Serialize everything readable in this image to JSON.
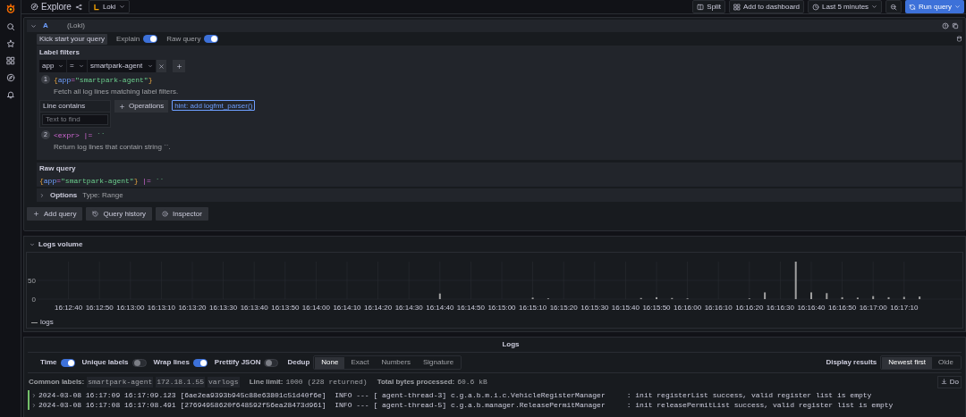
{
  "top_bar": {
    "title": "Explore",
    "datasource": "Loki",
    "buttons": [
      {
        "kind": "split",
        "label": "Split"
      },
      {
        "kind": "dashboard",
        "label": "Add to dashboard"
      },
      {
        "kind": "time",
        "label": "Last 5 minutes"
      },
      {
        "kind": "zoom"
      },
      {
        "kind": "run",
        "label": "Run query"
      }
    ]
  },
  "query": {
    "letter": "A",
    "datasource": "(Loki)",
    "kick_start": "Kick start your query",
    "toggles": [
      {
        "label": "Explain",
        "on": true
      },
      {
        "label": "Raw query",
        "on": true
      }
    ],
    "label_filters": {
      "title": "Label filters",
      "label": "app",
      "operator": "=",
      "value": "smartpark-agent"
    },
    "steps": [
      {
        "number": "1",
        "code": [
          {
            "text": "{",
            "kind": "punct"
          },
          {
            "text": "app",
            "kind": "label"
          },
          {
            "text": "=",
            "kind": "op"
          },
          {
            "text": "\"smartpark-agent\"",
            "kind": "string"
          },
          {
            "text": "}",
            "kind": "punct"
          }
        ],
        "description": "Fetch all log lines matching label filters."
      },
      {
        "number": "2",
        "code": [
          {
            "text": "<expr>",
            "kind": "op"
          },
          {
            "text": " |= ",
            "kind": "op"
          },
          {
            "text": "``",
            "kind": "string"
          }
        ],
        "description": "Return log lines that contain string ``."
      }
    ],
    "operation": {
      "title": "Line contains",
      "placeholder": "Text to find",
      "button": "Operations",
      "hint": "hint: add logfmt_parser()"
    },
    "raw_query": {
      "title": "Raw query",
      "code": [
        {
          "text": "{",
          "kind": "punct"
        },
        {
          "text": "app",
          "kind": "label"
        },
        {
          "text": "=",
          "kind": "op"
        },
        {
          "text": "\"smartpark-agent\"",
          "kind": "string"
        },
        {
          "text": "}",
          "kind": "punct"
        },
        {
          "text": " |= ",
          "kind": "op"
        },
        {
          "text": "``",
          "kind": "string"
        }
      ]
    },
    "options": {
      "label": "Options",
      "type": "Type: Range"
    },
    "actions": [
      {
        "kind": "add",
        "label": "Add query"
      },
      {
        "kind": "history",
        "label": "Query history"
      },
      {
        "kind": "info",
        "label": "Inspector"
      }
    ]
  },
  "logs_volume": {
    "title": "Logs volume",
    "chart_data": {
      "type": "bar",
      "categories": [
        null,
        null,
        "16:12:40",
        null,
        "16:12:50",
        null,
        "16:13:00",
        null,
        "16:13:10",
        null,
        "16:13:20",
        null,
        "16:13:30",
        null,
        "16:13:40",
        null,
        "16:13:50",
        null,
        "16:14:00",
        null,
        "16:14:10",
        null,
        "16:14:20",
        null,
        "16:14:30",
        null,
        "16:14:40",
        null,
        "16:14:50",
        null,
        "16:15:00",
        null,
        "16:15:10",
        null,
        "16:15:20",
        null,
        "16:15:30",
        null,
        "16:15:40",
        null,
        "16:15:50",
        null,
        "16:16:00",
        null,
        "16:16:10",
        null,
        "16:16:20",
        null,
        "16:16:30",
        null,
        "16:16:40",
        null,
        "16:16:50",
        null,
        "16:17:00",
        null,
        "16:17:10",
        null,
        null,
        null
      ],
      "series": [
        {
          "name": "logs",
          "color": "#a0a0a0",
          "values": [
            null,
            null,
            null,
            null,
            null,
            null,
            null,
            null,
            null,
            null,
            null,
            null,
            null,
            null,
            null,
            null,
            null,
            null,
            null,
            null,
            null,
            null,
            null,
            null,
            null,
            null,
            15,
            null,
            null,
            null,
            null,
            null,
            4,
            2,
            null,
            null,
            null,
            null,
            null,
            3,
            5,
            3,
            2,
            null,
            null,
            null,
            2,
            18,
            null,
            100,
            18,
            16,
            5,
            4,
            8,
            5,
            6,
            7,
            null,
            null
          ]
        }
      ],
      "ylim": [
        0,
        100
      ],
      "yticks": [
        0,
        50
      ],
      "grid": true
    }
  },
  "logs": {
    "title": "Logs",
    "toggles": [
      {
        "label": "Time",
        "on": true
      },
      {
        "label": "Unique labels",
        "on": false
      },
      {
        "label": "Wrap lines",
        "on": true
      },
      {
        "label": "Prettify JSON",
        "on": false
      }
    ],
    "dedup": {
      "label": "Dedup",
      "options": [
        {
          "label": "None",
          "selected": true
        },
        {
          "label": "Exact",
          "selected": false
        },
        {
          "label": "Numbers",
          "selected": false
        },
        {
          "label": "Signature",
          "selected": false
        }
      ]
    },
    "display": {
      "label": "Display results",
      "options": [
        {
          "label": "Newest first",
          "selected": true
        },
        {
          "label": "Olde",
          "selected": false
        }
      ]
    },
    "common_labels": {
      "label": "Common labels:",
      "values": [
        "smartpark-agent",
        "172.18.1.55",
        "varlogs"
      ]
    },
    "line_limit": {
      "label": "Line limit:",
      "value": "1000 (228 returned)"
    },
    "bytes": {
      "label": "Total bytes processed:",
      "value": "60.6 kB"
    },
    "download": "Do",
    "rows": [
      {
        "text": "2024-03-08 16:17:09 16:17:09.123 [6ae2ea9393b945c88e63801c51d40f6e]  INFO --- [ agent-thread-3] c.g.a.b.m.i.c.VehicleRegisterManager     : init registerList success, valid register list is empty"
      },
      {
        "text": "2024-03-08 16:17:08 16:17:08.491 [27694958620f648592f56ea28473d961]  INFO --- [ agent-thread-5] c.g.a.b.manager.ReleasePermitManager     : init releasePermitList success, valid register list is empty"
      }
    ]
  }
}
